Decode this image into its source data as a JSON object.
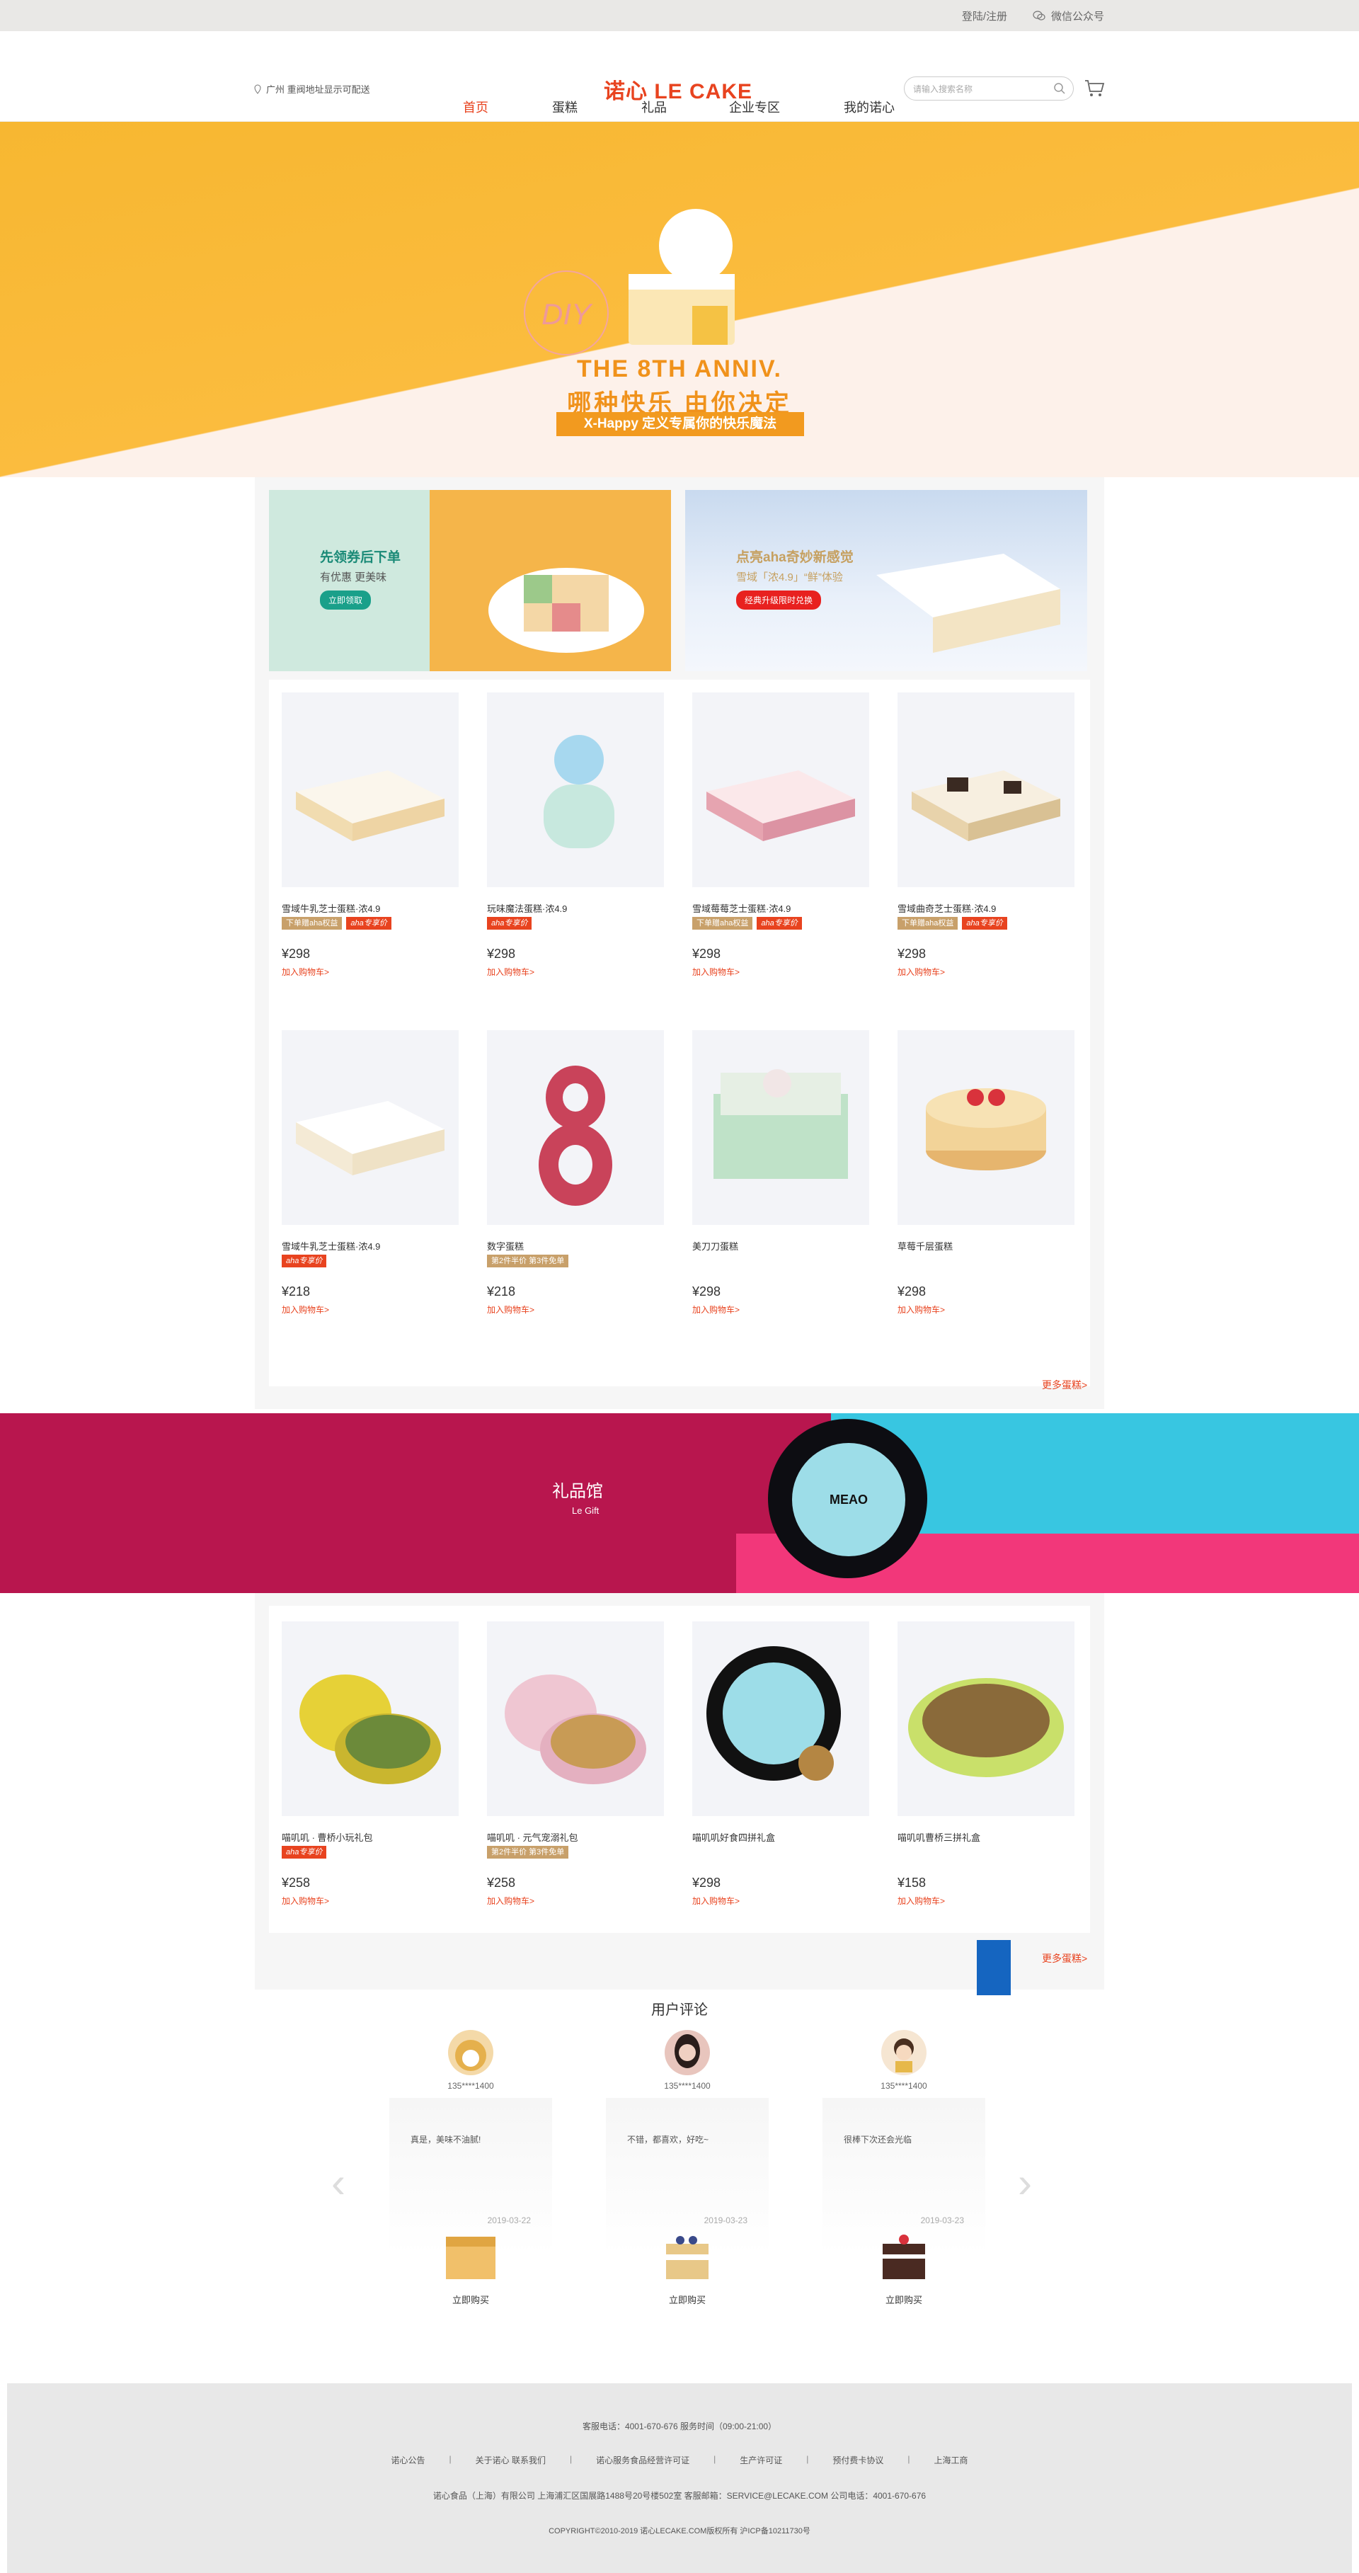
{
  "topbar": {
    "login": "登陆/注册",
    "wechat": "微信公众号"
  },
  "header": {
    "location": "广州 重阀地址显示可配送",
    "logo": "诺心 LE CAKE",
    "search_placeholder": "请输入搜索名称"
  },
  "nav": [
    "首页",
    "蛋糕",
    "礼品",
    "企业专区",
    "我的诺心"
  ],
  "hero": {
    "anniv": "THE 8TH ANNIV.",
    "slogan": "哪种快乐 由你决定",
    "sub": "X-Happy 定义专属你的快乐魔法",
    "diy": "DIY"
  },
  "banners": [
    {
      "title": "先领券后下单",
      "sub": "有优惠 更美味",
      "button": "立即领取",
      "button_color": "#1aa08a"
    },
    {
      "title": "点亮aha奇妙新感觉",
      "sub": "雪域「浓4.9」“鲜”体验",
      "button": "经典升级限时兑换",
      "button_color": "#e8211f"
    }
  ],
  "products": [
    {
      "name": "雪域牛乳芝士蛋糕·浓4.9",
      "tags": [
        "下单赠aha权益",
        "aha专享价"
      ],
      "price": "¥298",
      "add": "加入购物车>"
    },
    {
      "name": "玩味魔法蛋糕·浓4.9",
      "tags": [
        "aha专享价"
      ],
      "price": "¥298",
      "add": "加入购物车>"
    },
    {
      "name": "雪域莓莓芝士蛋糕·浓4.9",
      "tags": [
        "下单赠aha权益",
        "aha专享价"
      ],
      "price": "¥298",
      "add": "加入购物车>"
    },
    {
      "name": "雪域曲奇芝士蛋糕·浓4.9",
      "tags": [
        "下单赠aha权益",
        "aha专享价"
      ],
      "price": "¥298",
      "add": "加入购物车>"
    },
    {
      "name": "雪域牛乳芝士蛋糕·浓4.9",
      "tags": [
        "aha专享价"
      ],
      "price": "¥218",
      "add": "加入购物车>"
    },
    {
      "name": "数字蛋糕",
      "tags": [
        "第2件半价 第3件免单"
      ],
      "price": "¥218",
      "add": "加入购物车>"
    },
    {
      "name": "美刀刀蛋糕",
      "tags": [],
      "price": "¥298",
      "add": "加入购物车>"
    },
    {
      "name": "草莓千层蛋糕",
      "tags": [],
      "price": "¥298",
      "add": "加入购物车>"
    }
  ],
  "more_cakes": "更多蛋糕>",
  "gift": {
    "title": "礼品馆",
    "subtitle": "Le Gift",
    "tin_label": "MEAO"
  },
  "gifts": [
    {
      "name": "喵叽叽 · 曹桥小玩礼包",
      "tags": [
        "aha专享价"
      ],
      "price": "¥258",
      "add": "加入购物车>"
    },
    {
      "name": "喵叽叽 · 元气宠溺礼包",
      "tags": [
        "第2件半价 第3件免单"
      ],
      "price": "¥258",
      "add": "加入购物车>"
    },
    {
      "name": "喵叽叽好食四拼礼盒",
      "tags": [],
      "price": "¥298",
      "add": "加入购物车>"
    },
    {
      "name": "喵叽叽曹桥三拼礼盒",
      "tags": [],
      "price": "¥158",
      "add": "加入购物车>"
    }
  ],
  "more_gifts": "更多蛋糕>",
  "reviews_title": "用户评论",
  "reviews": [
    {
      "user": "135****1400",
      "text": "真是，美味不油腻!",
      "date": "2019-03-22",
      "buy": "立即购买"
    },
    {
      "user": "135****1400",
      "text": "不错，都喜欢，好吃~",
      "date": "2019-03-23",
      "buy": "立即购买"
    },
    {
      "user": "135****1400",
      "text": "很棒下次还会光临",
      "date": "2019-03-23",
      "buy": "立即购买"
    }
  ],
  "footer": {
    "hotline": "客服电话：4001-670-676 服务时间（09:00-21:00）",
    "links": [
      "诺心公告",
      "关于诺心 联系我们",
      "诺心服务食品经营许可证",
      "生产许可证",
      "预付费卡协议",
      "上海工商"
    ],
    "company": "诺心食品（上海）有限公司   上海浦汇区国展路1488号20号楼502室   客服邮箱：SERVICE@LECAKE.COM   公司电话：4001-670-676",
    "copyright": "COPYRIGHT©2010-2019 诺心LECAKE.COM版权所有 沪ICP备10211730号"
  },
  "colors": {
    "accent": "#e8431f",
    "gold": "#c8a06a",
    "hero_yellow": "#f7b731",
    "gift_red": "#b8164e",
    "gift_blue": "#38c6e1"
  }
}
